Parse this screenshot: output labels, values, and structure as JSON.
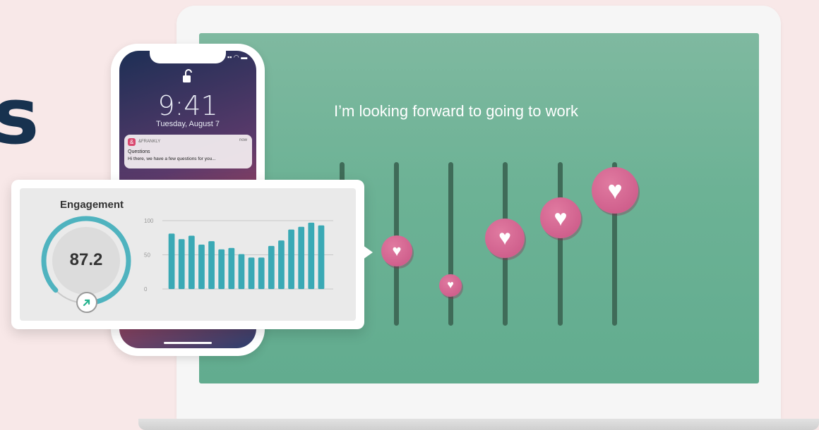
{
  "page": {
    "partial_heading_letter": "s"
  },
  "laptop": {
    "question": "I’m looking forward to going to work",
    "sliders": [
      {
        "level": 0.0
      },
      {
        "level": 0.46
      },
      {
        "level": 0.25
      },
      {
        "level": 0.52
      },
      {
        "level": 0.66
      },
      {
        "level": 0.84
      }
    ],
    "colors": {
      "screen": "#6cb295",
      "track": "#3f6b58",
      "knob": "#c95585"
    },
    "knob_icon": "heart-icon"
  },
  "phone": {
    "time": "9:41",
    "date": "Tuesday, August 7",
    "notification": {
      "app_icon_glyph": "&",
      "app": "&FRANKLY",
      "time": "now",
      "title": "Questions",
      "body": "Hi there, we have a few questions for you..."
    }
  },
  "engagement": {
    "title": "Engagement",
    "score": "87.2",
    "score_fraction": 0.872,
    "trend_icon": "arrow-up-right-icon",
    "colors": {
      "accent": "#4fb3bf",
      "bars": "#3aa9b5"
    }
  },
  "chart_data": {
    "type": "bar",
    "title": "",
    "xlabel": "",
    "ylabel": "",
    "ylim": [
      0,
      100
    ],
    "yticks": [
      0,
      50,
      100
    ],
    "ytick_labels": [
      "0",
      "50",
      "100"
    ],
    "grid": true,
    "values": [
      81,
      73,
      78,
      65,
      70,
      58,
      60,
      51,
      46,
      46,
      63,
      71,
      87,
      91,
      97,
      93
    ]
  }
}
